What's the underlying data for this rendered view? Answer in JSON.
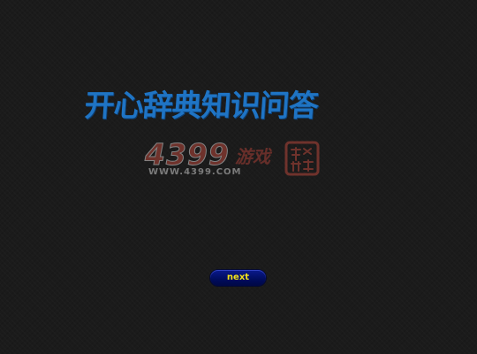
{
  "game": {
    "title": "开心辞典知识问答",
    "logo": {
      "digits": "4399",
      "brand": "游戏",
      "url": "WWW.4399.COM",
      "seal_text": "开心文化"
    },
    "next_button_label": "next"
  },
  "colors": {
    "background": "#1b1b1b",
    "title": "#1f74c4",
    "logo_red": "#b5463a",
    "button_bg": "#0a1a8e",
    "button_text": "#f2e21a"
  }
}
